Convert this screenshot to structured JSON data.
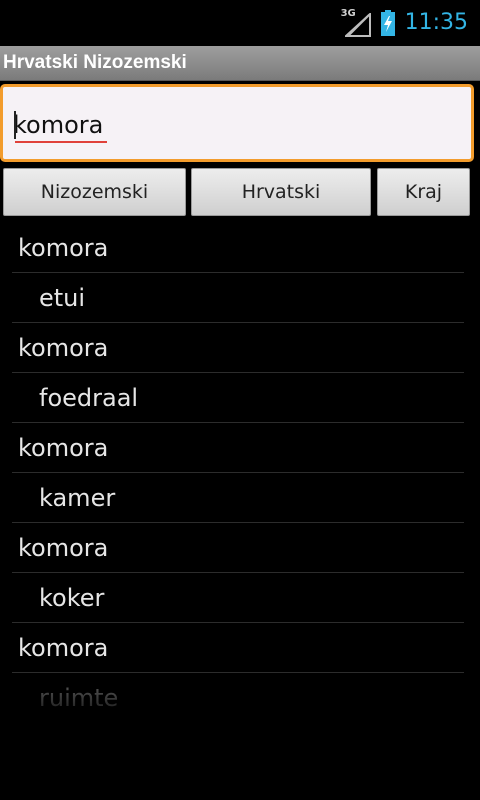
{
  "status_bar": {
    "network_type": "3G",
    "signal_icon": "signal-icon",
    "battery_icon": "battery-charging-icon",
    "time": "11:35",
    "clock_color": "#33b5e5"
  },
  "app": {
    "title": "Hrvatski Nizozemski"
  },
  "search": {
    "value": "komora",
    "focus_color": "#f39c2c"
  },
  "buttons": {
    "dutch_label": "Nizozemski",
    "croatian_label": "Hrvatski",
    "exit_label": "Kraj"
  },
  "results": [
    {
      "text": "komora",
      "kind": "word"
    },
    {
      "text": "etui",
      "kind": "translation"
    },
    {
      "text": "komora",
      "kind": "word"
    },
    {
      "text": "foedraal",
      "kind": "translation"
    },
    {
      "text": "komora",
      "kind": "word"
    },
    {
      "text": "kamer",
      "kind": "translation"
    },
    {
      "text": "komora",
      "kind": "word"
    },
    {
      "text": "koker",
      "kind": "translation"
    },
    {
      "text": "komora",
      "kind": "word"
    },
    {
      "text": "ruimte",
      "kind": "translation"
    }
  ]
}
